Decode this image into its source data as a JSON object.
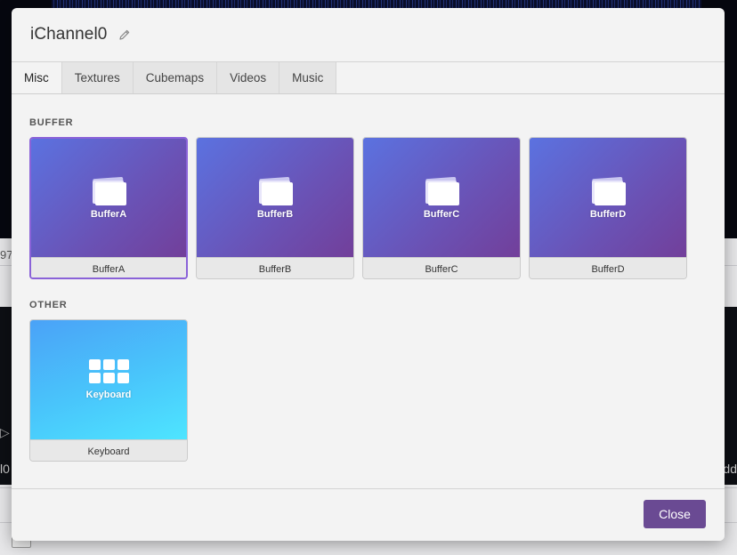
{
  "background": {
    "left_text": "97",
    "left_text2": "l0",
    "right_text": "dd",
    "arrow": "▷"
  },
  "modal": {
    "title": "iChannel0",
    "tabs": [
      "Misc",
      "Textures",
      "Cubemaps",
      "Videos",
      "Music"
    ],
    "active_tab": "Misc",
    "sections": {
      "buffer": {
        "label": "BUFFER",
        "items": [
          {
            "thumb_label": "BufferA",
            "name": "BufferA",
            "selected": true
          },
          {
            "thumb_label": "BufferB",
            "name": "BufferB",
            "selected": false
          },
          {
            "thumb_label": "BufferC",
            "name": "BufferC",
            "selected": false
          },
          {
            "thumb_label": "BufferD",
            "name": "BufferD",
            "selected": false
          }
        ]
      },
      "other": {
        "label": "OTHER",
        "items": [
          {
            "thumb_label": "Keyboard",
            "name": "Keyboard",
            "selected": false
          }
        ]
      }
    },
    "close_label": "Close",
    "colors": {
      "accent": "#6a4a93",
      "selected_border": "#8a62d8",
      "buffer_gradient_start": "#5b72e0",
      "buffer_gradient_end": "#723f9a",
      "keyboard_gradient_start": "#4aa2f7",
      "keyboard_gradient_end": "#4ee5ff"
    },
    "icons": {
      "edit": "pencil-icon",
      "buffer": "stacked-pages-icon",
      "keyboard": "keyboard-grid-icon"
    }
  }
}
